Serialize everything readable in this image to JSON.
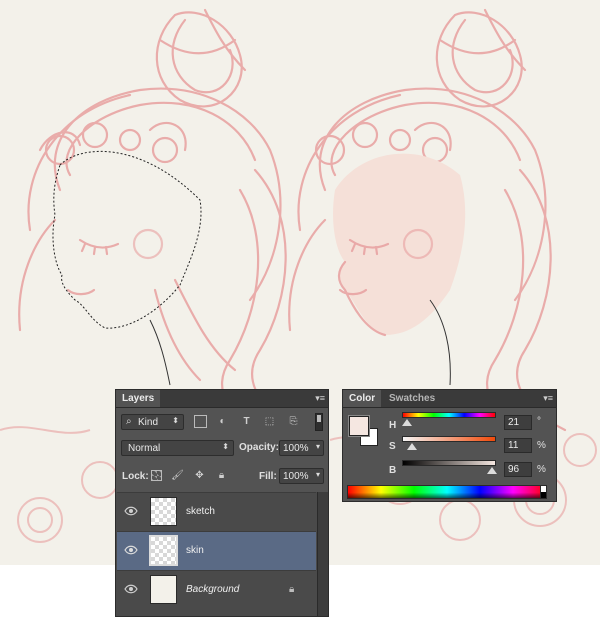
{
  "layers_panel": {
    "tab_label": "Layers",
    "filter": {
      "kind_label": "Kind"
    },
    "blend_mode": "Normal",
    "opacity_label": "Opacity:",
    "opacity_value": "100%",
    "lock_label": "Lock:",
    "fill_label": "Fill:",
    "fill_value": "100%",
    "layers": [
      {
        "name": "sketch",
        "visible": true,
        "selected": false
      },
      {
        "name": "skin",
        "visible": true,
        "selected": true
      },
      {
        "name": "Background",
        "visible": true,
        "selected": false,
        "locked": true
      }
    ]
  },
  "color_panel": {
    "tabs": [
      "Color",
      "Swatches"
    ],
    "active_tab": "Color",
    "h_label": "H",
    "h_value": "21",
    "h_unit": "°",
    "s_label": "S",
    "s_value": "11",
    "s_unit": "%",
    "b_label": "B",
    "b_value": "96",
    "b_unit": "%",
    "h_fraction": 0.058,
    "s_fraction": 0.11,
    "b_fraction": 0.96,
    "foreground_color": "#f5e7e1",
    "background_color": "#ffffff"
  },
  "colors": {
    "canvas": "#f3f1ea",
    "sketch_line": "#e8a0a0",
    "skin_fill": "#f5e0d8",
    "selected_row": "#5a6a85"
  }
}
